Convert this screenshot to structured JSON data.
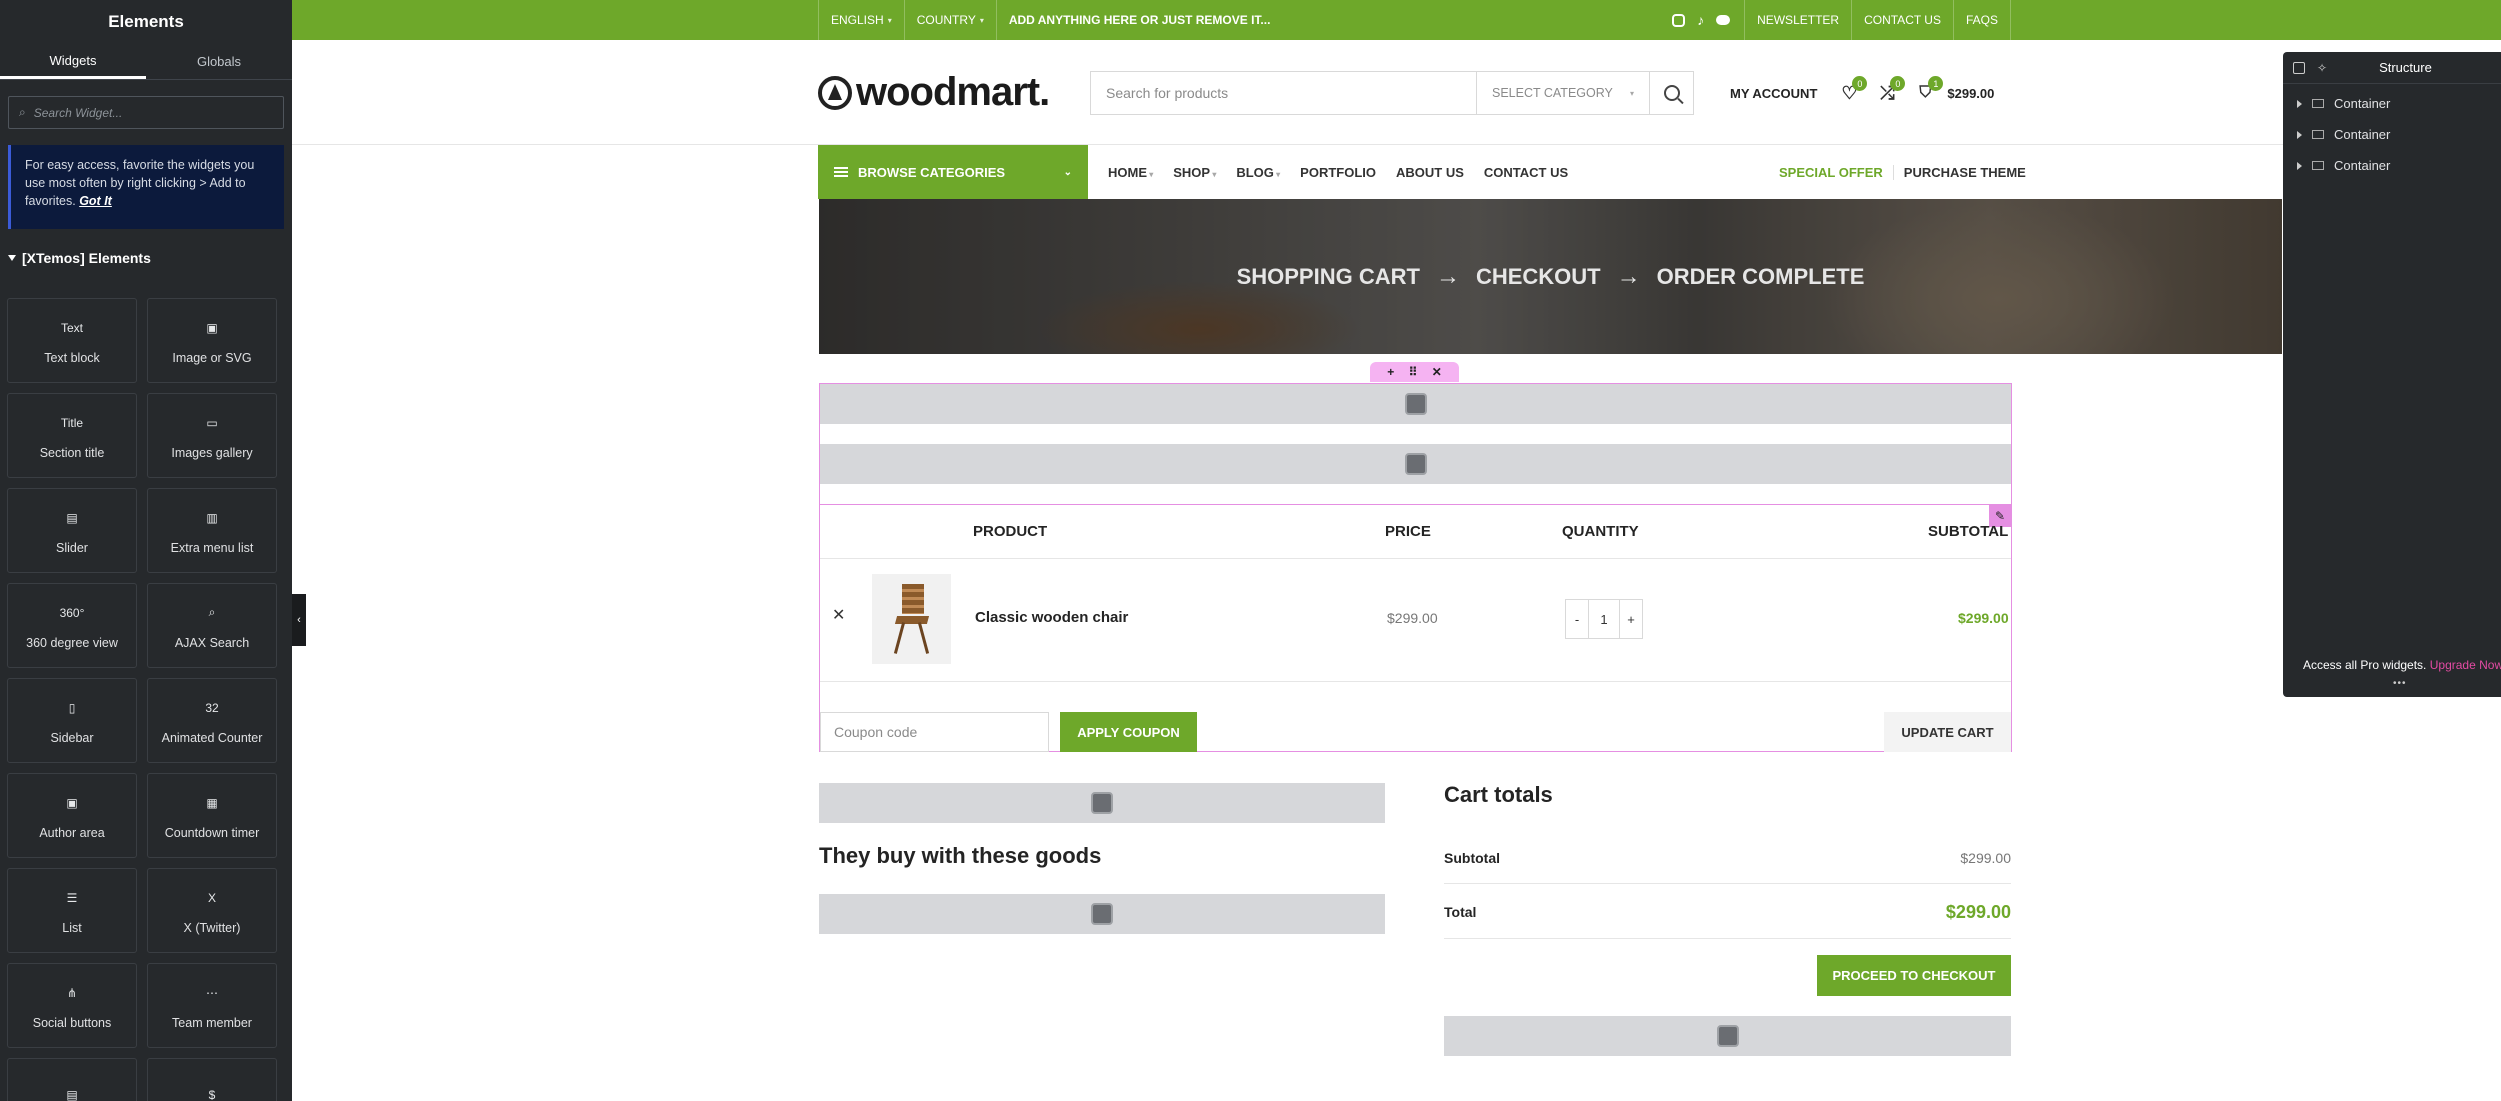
{
  "left_panel": {
    "title": "Elements",
    "tabs": [
      "Widgets",
      "Globals"
    ],
    "search_placeholder": "Search Widget...",
    "notice_text": "For easy access, favorite the widgets you use most often by right clicking > Add to favorites.",
    "notice_link": "Got It",
    "category": "[XTemos] Elements",
    "widgets": [
      {
        "label": "Text block",
        "icon": "text-block-icon"
      },
      {
        "label": "Image or SVG",
        "icon": "image-svg-icon"
      },
      {
        "label": "Section title",
        "icon": "section-title-icon"
      },
      {
        "label": "Images gallery",
        "icon": "images-gallery-icon"
      },
      {
        "label": "Slider",
        "icon": "slider-icon"
      },
      {
        "label": "Extra menu list",
        "icon": "extra-menu-list-icon"
      },
      {
        "label": "360 degree view",
        "icon": "360-view-icon"
      },
      {
        "label": "AJAX Search",
        "icon": "ajax-search-icon"
      },
      {
        "label": "Sidebar",
        "icon": "sidebar-icon"
      },
      {
        "label": "Animated Counter",
        "icon": "animated-counter-icon"
      },
      {
        "label": "Author area",
        "icon": "author-area-icon"
      },
      {
        "label": "Countdown timer",
        "icon": "countdown-timer-icon"
      },
      {
        "label": "List",
        "icon": "list-icon"
      },
      {
        "label": "X (Twitter)",
        "icon": "x-twitter-icon"
      },
      {
        "label": "Social buttons",
        "icon": "social-buttons-icon"
      },
      {
        "label": "Team member",
        "icon": "team-member-icon"
      },
      {
        "label": "",
        "icon": "widget-icon"
      },
      {
        "label": "",
        "icon": "price-widget-icon"
      }
    ],
    "widget_glyphs": [
      "Text",
      "▣",
      "Title",
      "▭",
      "▤",
      "▥",
      "360°",
      "⌕",
      "▯",
      "32",
      "▣",
      "▦",
      "☰",
      "X",
      "⋔",
      "⋯",
      "▤",
      "$"
    ]
  },
  "topbar": {
    "language": "ENGLISH",
    "country": "COUNTRY",
    "promo": "ADD ANYTHING HERE OR JUST REMOVE IT...",
    "links": [
      "NEWSLETTER",
      "CONTACT US",
      "FAQS"
    ]
  },
  "header": {
    "logo_text": "woodmart.",
    "search_placeholder": "Search for products",
    "select_category": "SELECT CATEGORY",
    "account": "MY ACCOUNT",
    "wishlist_count": "0",
    "compare_count": "0",
    "cart_count": "1",
    "cart_total": "$299.00"
  },
  "nav": {
    "browse": "BROWSE CATEGORIES",
    "items": [
      {
        "label": "HOME",
        "caret": true
      },
      {
        "label": "SHOP",
        "caret": true
      },
      {
        "label": "BLOG",
        "caret": true
      },
      {
        "label": "PORTFOLIO",
        "caret": false
      },
      {
        "label": "ABOUT US",
        "caret": false
      },
      {
        "label": "CONTACT US",
        "caret": false
      }
    ],
    "special_offer": "SPECIAL OFFER",
    "purchase_theme": "PURCHASE THEME"
  },
  "banner": {
    "steps": [
      "SHOPPING CART",
      "CHECKOUT",
      "ORDER COMPLETE"
    ]
  },
  "cart": {
    "headers": {
      "product": "PRODUCT",
      "price": "PRICE",
      "quantity": "QUANTITY",
      "subtotal": "SUBTOTAL"
    },
    "items": [
      {
        "name": "Classic wooden chair",
        "price": "$299.00",
        "qty": "1",
        "subtotal": "$299.00"
      }
    ],
    "coupon_placeholder": "Coupon code",
    "apply_coupon": "APPLY COUPON",
    "update_cart": "UPDATE CART"
  },
  "related": {
    "heading": "They buy with these goods"
  },
  "totals": {
    "title": "Cart totals",
    "subtotal_label": "Subtotal",
    "subtotal_value": "$299.00",
    "total_label": "Total",
    "total_value": "$299.00",
    "checkout": "PROCEED TO CHECKOUT"
  },
  "structure": {
    "title": "Structure",
    "items": [
      "Container",
      "Container",
      "Container"
    ],
    "promo_text": "Access all Pro widgets.",
    "promo_link": "Upgrade Now"
  },
  "colors": {
    "accent": "#6ea82a",
    "panel_bg": "#26292c",
    "editor_highlight": "#e58fe2"
  }
}
